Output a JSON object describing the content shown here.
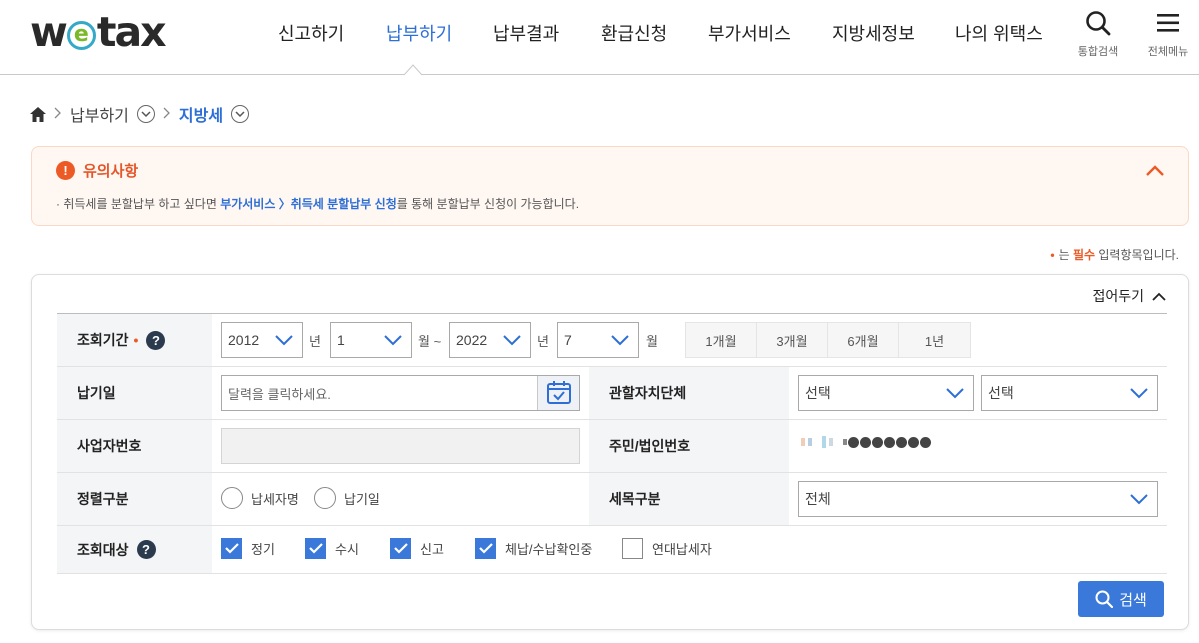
{
  "header": {
    "logo": "wetax",
    "nav": [
      "신고하기",
      "납부하기",
      "납부결과",
      "환급신청",
      "부가서비스",
      "지방세정보",
      "나의 위택스"
    ],
    "active_nav": "납부하기",
    "search_label": "통합검색",
    "menu_label": "전체메뉴"
  },
  "breadcrumb": {
    "items": [
      "납부하기",
      "지방세"
    ],
    "home_icon": "home-icon"
  },
  "notice": {
    "title": "유의사항",
    "body_pre": "· 취득세를 분할납부 하고 싶다면 ",
    "body_link": "부가서비스 〉취득세 분할납부 신청",
    "body_post": "를 통해 분할납부 신청이 가능합니다."
  },
  "required_note": {
    "pre": "는 ",
    "em": "필수",
    "post": " 입력항목입니다."
  },
  "panel": {
    "fold_label": "접어두기",
    "rows": {
      "period": {
        "label": "조회기간",
        "start_year": "2012",
        "start_year_unit": "년",
        "start_month": "1",
        "start_month_unit": "월 ~",
        "end_year": "2022",
        "end_year_unit": "년",
        "end_month": "7",
        "end_month_unit": "월",
        "quick": [
          "1개월",
          "3개월",
          "6개월",
          "1년"
        ]
      },
      "pay_date": {
        "label": "납기일",
        "placeholder": "달력을 클릭하세요."
      },
      "local_gov": {
        "label": "관할자치단체",
        "select1": "선택",
        "select2": "선택"
      },
      "business_no": {
        "label": "사업자번호"
      },
      "resident_no": {
        "label": "주민/법인번호"
      },
      "sort": {
        "label": "정렬구분",
        "options": [
          "납세자명",
          "납기일"
        ]
      },
      "tax_type": {
        "label": "세목구분",
        "value": "전체"
      },
      "target": {
        "label": "조회대상",
        "options": [
          {
            "label": "정기",
            "checked": true
          },
          {
            "label": "수시",
            "checked": true
          },
          {
            "label": "신고",
            "checked": true
          },
          {
            "label": "체납/수납확인중",
            "checked": true
          },
          {
            "label": "연대납세자",
            "checked": false
          }
        ]
      }
    },
    "search_button": "검색"
  },
  "colors": {
    "brand_blue": "#2d6fd6",
    "button_blue": "#3a79d9",
    "warning_orange": "#ec5a26",
    "notice_bg": "#fff7f2"
  }
}
